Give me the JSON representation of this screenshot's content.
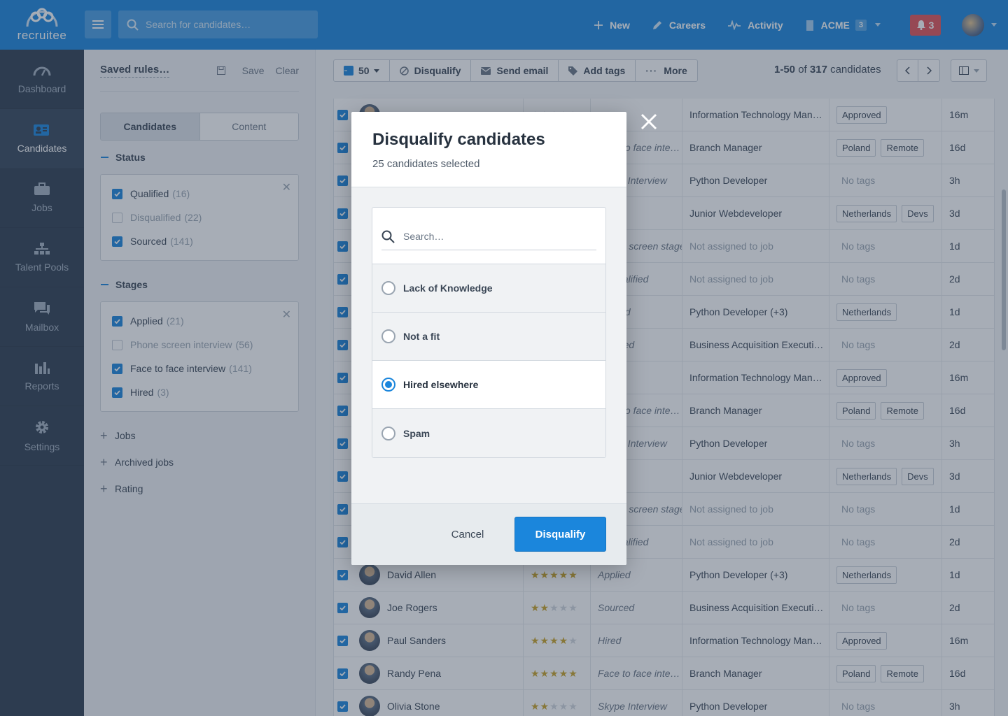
{
  "app": {
    "logo_text": "recruitee"
  },
  "topbar": {
    "search_placeholder": "Search for candidates…",
    "new_label": "New",
    "careers_label": "Careers",
    "activity_label": "Activity",
    "company_label": "ACME",
    "company_badge": "3",
    "notifications_count": "3"
  },
  "sidebar": {
    "items": [
      {
        "label": "Dashboard",
        "icon": "dashboard-icon"
      },
      {
        "label": "Candidates",
        "icon": "candidates-icon"
      },
      {
        "label": "Jobs",
        "icon": "briefcase-icon"
      },
      {
        "label": "Talent Pools",
        "icon": "org-chart-icon"
      },
      {
        "label": "Mailbox",
        "icon": "chat-icon"
      },
      {
        "label": "Reports",
        "icon": "bar-chart-icon"
      },
      {
        "label": "Settings",
        "icon": "gear-icon"
      }
    ]
  },
  "filters": {
    "saved_rules": "Saved rules…",
    "save_label": "Save",
    "clear_label": "Clear",
    "tabs": [
      "Candidates",
      "Content"
    ],
    "status_heading": "Status",
    "status": [
      {
        "label": "Qualified",
        "count": "(16)",
        "checked": true
      },
      {
        "label": "Disqualified",
        "count": "(22)",
        "checked": false
      },
      {
        "label": "Sourced",
        "count": "(141)",
        "checked": true
      }
    ],
    "stages_heading": "Stages",
    "stages": [
      {
        "label": "Applied",
        "count": "(21)",
        "checked": true
      },
      {
        "label": "Phone screen interview",
        "count": "(56)",
        "checked": false
      },
      {
        "label": "Face to face interview",
        "count": "(141)",
        "checked": true
      },
      {
        "label": "Hired",
        "count": "(3)",
        "checked": true
      }
    ],
    "collapsed": [
      "Jobs",
      "Archived jobs",
      "Rating"
    ]
  },
  "toolbar": {
    "select_count": "50",
    "disqualify_label": "Disqualify",
    "send_email_label": "Send email",
    "add_tags_label": "Add tags",
    "more_label": "More",
    "range": "1-50",
    "of_label": "of",
    "total": "317",
    "total_label": "candidates"
  },
  "rows": [
    {
      "name": "",
      "rating": 0,
      "stage": "",
      "job": "Information Technology Man…",
      "job_muted": false,
      "tags": [
        "Approved"
      ],
      "time": "16m"
    },
    {
      "name": "",
      "rating": 0,
      "stage": "Face to face inte…",
      "job": "Branch Manager",
      "job_muted": false,
      "tags": [
        "Poland",
        "Remote"
      ],
      "time": "16d"
    },
    {
      "name": "",
      "rating": 0,
      "stage": "Skype Interview",
      "job": "Python Developer",
      "job_muted": false,
      "tags": [],
      "time": "3h"
    },
    {
      "name": "",
      "rating": 0,
      "stage": "",
      "job": "Junior Webdeveloper",
      "job_muted": false,
      "tags": [
        "Netherlands",
        "Devs"
      ],
      "time": "3d"
    },
    {
      "name": "",
      "rating": 0,
      "stage": "Phone screen stage",
      "job": "Not assigned to job",
      "job_muted": true,
      "tags": [],
      "time": "1d"
    },
    {
      "name": "",
      "rating": 0,
      "stage": "Disqualified",
      "job": "Not assigned to job",
      "job_muted": true,
      "tags": [],
      "time": "2d"
    },
    {
      "name": "",
      "rating": 0,
      "stage": "Applied",
      "job": "Python Developer (+3)",
      "job_muted": false,
      "tags": [
        "Netherlands"
      ],
      "time": "1d"
    },
    {
      "name": "",
      "rating": 0,
      "stage": "Sourced",
      "job": "Business Acquisition Executi…",
      "job_muted": false,
      "tags": [],
      "time": "2d"
    },
    {
      "name": "",
      "rating": 0,
      "stage": "",
      "job": "Information Technology Man…",
      "job_muted": false,
      "tags": [
        "Approved"
      ],
      "time": "16m"
    },
    {
      "name": "",
      "rating": 0,
      "stage": "Face to face inte…",
      "job": "Branch Manager",
      "job_muted": false,
      "tags": [
        "Poland",
        "Remote"
      ],
      "time": "16d"
    },
    {
      "name": "",
      "rating": 0,
      "stage": "Skype Interview",
      "job": "Python Developer",
      "job_muted": false,
      "tags": [],
      "time": "3h"
    },
    {
      "name": "",
      "rating": 0,
      "stage": "",
      "job": "Junior Webdeveloper",
      "job_muted": false,
      "tags": [
        "Netherlands",
        "Devs"
      ],
      "time": "3d"
    },
    {
      "name": "",
      "rating": 0,
      "stage": "Phone screen stage",
      "job": "Not assigned to job",
      "job_muted": true,
      "tags": [],
      "time": "1d"
    },
    {
      "name": "",
      "rating": 0,
      "stage": "Disqualified",
      "job": "Not assigned to job",
      "job_muted": true,
      "tags": [],
      "time": "2d"
    },
    {
      "name": "David Allen",
      "rating": 5,
      "stage": "Applied",
      "job": "Python Developer (+3)",
      "job_muted": false,
      "tags": [
        "Netherlands"
      ],
      "time": "1d"
    },
    {
      "name": "Joe Rogers",
      "rating": 2,
      "stage": "Sourced",
      "job": "Business Acquisition Executi…",
      "job_muted": false,
      "tags": [],
      "time": "2d"
    },
    {
      "name": "Paul Sanders",
      "rating": 4,
      "stage": "Hired",
      "job": "Information Technology Man…",
      "job_muted": false,
      "tags": [
        "Approved"
      ],
      "time": "16m"
    },
    {
      "name": "Randy Pena",
      "rating": 5,
      "stage": "Face to face inte…",
      "job": "Branch Manager",
      "job_muted": false,
      "tags": [
        "Poland",
        "Remote"
      ],
      "time": "16d"
    },
    {
      "name": "Olivia Stone",
      "rating": 2,
      "stage": "Skype Interview",
      "job": "Python Developer",
      "job_muted": false,
      "tags": [],
      "time": "3h"
    }
  ],
  "no_tags_label": "No tags",
  "modal": {
    "title": "Disqualify candidates",
    "subtitle": "25 candidates selected",
    "search_placeholder": "Search…",
    "options": [
      {
        "label": "Lack of Knowledge",
        "selected": false
      },
      {
        "label": "Not a fit",
        "selected": false
      },
      {
        "label": "Hired elsewhere",
        "selected": true
      },
      {
        "label": "Spam",
        "selected": false
      }
    ],
    "cancel_label": "Cancel",
    "confirm_label": "Disqualify"
  },
  "colors": {
    "brand": "#1b86dc",
    "nav": "#2e3d50",
    "alert": "#e25156",
    "star": "#c9a227"
  }
}
